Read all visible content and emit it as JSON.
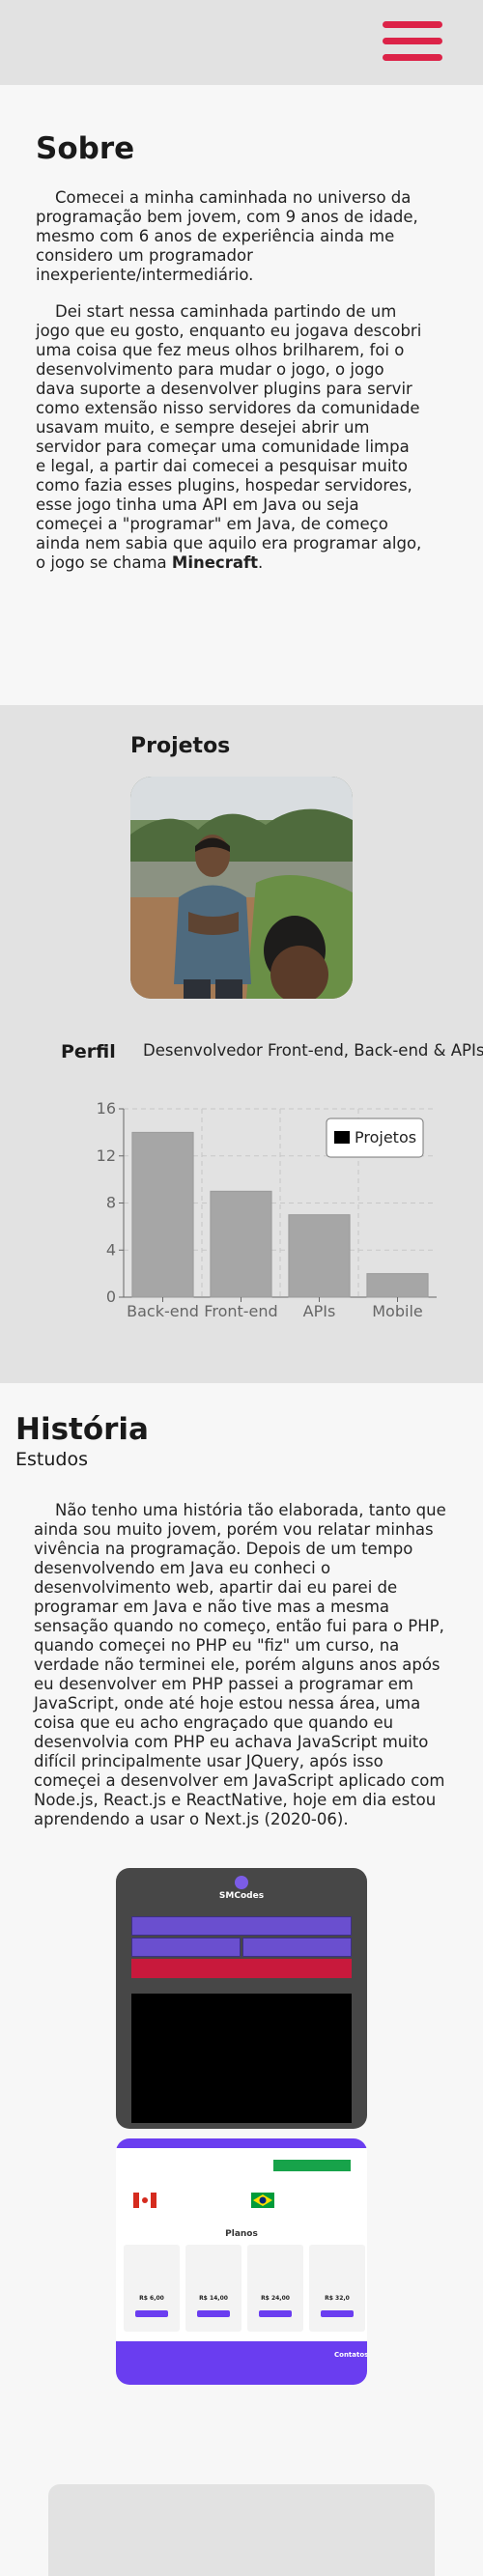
{
  "header": {
    "menu_icon": "hamburger-menu-icon",
    "accent_color": "#dc2348"
  },
  "sobre": {
    "title": "Sobre",
    "paragraph1": "Comecei a minha caminhada no universo da programação bem jovem, com 9 anos de idade, mesmo com 6 anos de experiência ainda me considero um programador inexperiente/intermediário.",
    "paragraph2_text": "Dei start nessa caminhada partindo de um jogo que eu gosto, enquanto eu jogava descobri uma coisa que fez meus olhos brilharem, foi o desenvolvimento para mudar o jogo, o jogo dava suporte a desenvolver plugins para servir como extensão nisso servidores da comunidade usavam muito, e sempre desejei abrir um servidor para começar uma comunidade limpa e legal, a partir dai comecei a pesquisar muito como fazia esses plugins, hospedar servidores, esse jogo tinha uma API em Java ou seja começei a \"programar\" em Java, de começo ainda nem sabia que aquilo era programar algo, o jogo se chama ",
    "paragraph2_bold": "Minecraft",
    "paragraph2_end": "."
  },
  "projetos": {
    "title": "Projetos",
    "perfil_label": "Perfil",
    "perfil_desc": "Desenvolvedor Front-end, Back-end & APIs"
  },
  "chart_data": {
    "type": "bar",
    "categories": [
      "Back-end",
      "Front-end",
      "APIs",
      "Mobile"
    ],
    "series": [
      {
        "name": "Projetos",
        "values": [
          14,
          9,
          7,
          2
        ]
      }
    ],
    "ylim": [
      0,
      16
    ],
    "yticks": [
      0,
      4,
      8,
      12,
      16
    ],
    "grid": true,
    "legend_position": "top-right",
    "bar_color": "#a6a6a6"
  },
  "historia": {
    "title": "História",
    "subtitle": "Estudos",
    "paragraph": "Não tenho uma história tão elaborada, tanto que ainda sou muito jovem, porém vou relatar minhas vivência na programação. Depois de um tempo desenvolvendo em Java eu conheci o desenvolvimento web, apartir dai eu parei de programar em Java e não tive mas a mesma sensação quando no começo, então fui para o PHP, quando começei no PHP eu \"fiz\" um curso, na verdade não terminei ele, porém alguns anos após eu desenvolver em PHP passei a programar em JavaScript, onde até hoje estou nessa área, uma coisa que eu acho engraçado que quando eu desenvolvia com PHP eu achava JavaScript muito difícil principalmente usar JQuery, após isso começei a desenvolver em JavaScript aplicado com Node.js, React.js e ReactNative, hoje em dia estou aprendendo a usar o Next.js (2020-06)."
  },
  "screenshot1": {
    "brand": "SMCodes"
  },
  "screenshot2": {
    "plans_title": "Planos",
    "prices": [
      "R$ 6,00",
      "R$ 14,00",
      "R$ 24,00",
      "R$ 32,0"
    ],
    "contacts": "Contatos"
  }
}
